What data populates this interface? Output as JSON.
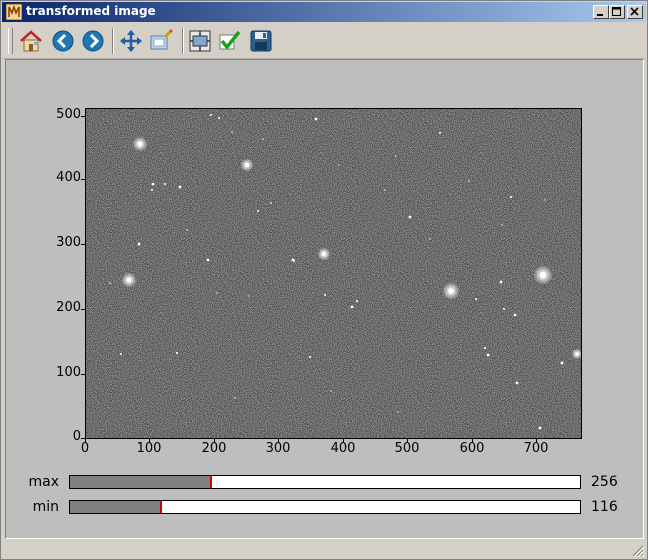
{
  "window": {
    "title": "transformed image"
  },
  "titlebar_buttons": [
    {
      "name": "minimize-button",
      "icon": "minimize-icon"
    },
    {
      "name": "maximize-button",
      "icon": "maximize-icon"
    },
    {
      "name": "close-button",
      "icon": "close-icon"
    }
  ],
  "toolbar": {
    "tools": [
      {
        "name": "home-button",
        "icon": "home-icon"
      },
      {
        "name": "back-button",
        "icon": "back-arrow-icon"
      },
      {
        "name": "forward-button",
        "icon": "forward-arrow-icon"
      },
      {
        "name": "pan-button",
        "icon": "move-arrows-icon"
      },
      {
        "name": "zoom-button",
        "icon": "zoom-rect-icon"
      },
      {
        "name": "configure-subplots-button",
        "icon": "subplots-icon"
      },
      {
        "name": "edit-parameters-button",
        "icon": "checkmark-icon"
      },
      {
        "name": "save-button",
        "icon": "floppy-disk-icon"
      }
    ]
  },
  "plot": {
    "x_ticks": [
      "0",
      "100",
      "200",
      "300",
      "400",
      "500",
      "600",
      "700"
    ],
    "y_ticks": [
      "0",
      "100",
      "200",
      "300",
      "400",
      "500"
    ],
    "x_range": [
      0,
      770
    ],
    "y_range": [
      0,
      510
    ]
  },
  "sliders": {
    "max": {
      "label": "max",
      "value": "256",
      "fraction": 0.279
    },
    "min": {
      "label": "min",
      "value": "116",
      "fraction": 0.181
    }
  },
  "colors": {
    "titlebar_start": "#0a246a",
    "titlebar_end": "#a6caf0",
    "image_background": "#2a2a2a",
    "slider_fill": "#808080",
    "slider_marker": "#cc0000"
  }
}
